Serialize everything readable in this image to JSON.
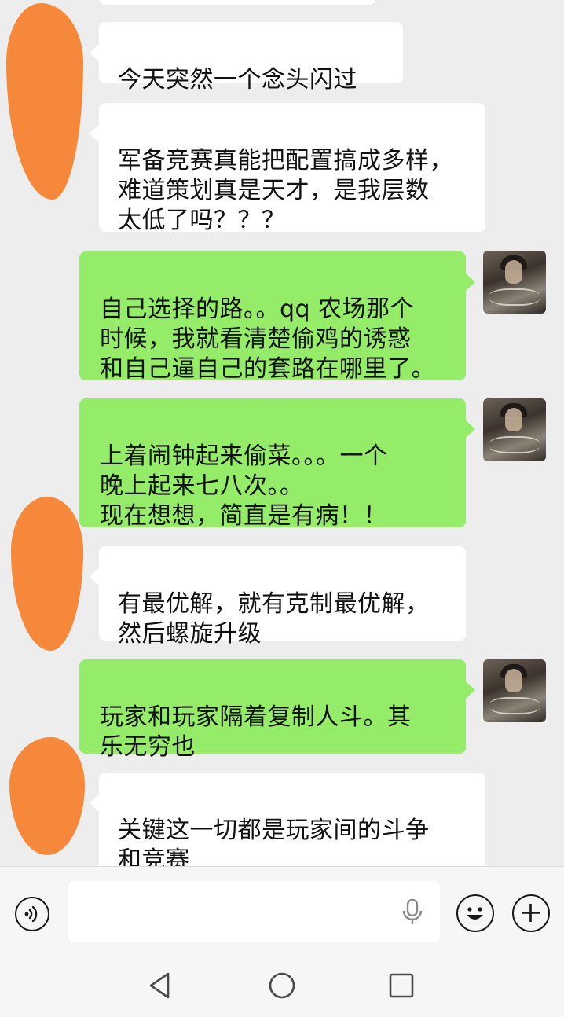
{
  "messages": [
    {
      "sender": "other",
      "text": "今天突然一个念头闪过"
    },
    {
      "sender": "other",
      "text": "军备竞赛真能把配置搞成多样，\n难道策划真是天才，是我层数\n太低了吗？？？"
    },
    {
      "sender": "me",
      "text": "自己选择的路。。qq 农场那个\n时候，我就看清楚偷鸡的诱惑\n和自己逼自己的套路在哪里了。"
    },
    {
      "sender": "me",
      "text": "上着闹钟起来偷菜。。。一个\n晚上起来七八次。。\n现在想想，简直是有病！！"
    },
    {
      "sender": "other",
      "text": "有最优解，就有克制最优解，\n然后螺旋升级"
    },
    {
      "sender": "me",
      "text": "玩家和玩家隔着复制人斗。其\n乐无穷也"
    },
    {
      "sender": "other",
      "text": "关键这一切都是玩家间的斗争\n和竞赛"
    }
  ],
  "input": {
    "value": ""
  },
  "icons": {
    "voice": "voice-toggle-icon",
    "mic": "microphone-icon",
    "emoji": "emoji-icon",
    "plus": "plus-icon",
    "nav_back": "nav-back-icon",
    "nav_home": "nav-home-icon",
    "nav_recent": "nav-recent-icon"
  },
  "colors": {
    "chat_bg": "#ededed",
    "incoming_bubble": "#ffffff",
    "outgoing_bubble": "#95ec69",
    "redaction": "#f5883a"
  }
}
